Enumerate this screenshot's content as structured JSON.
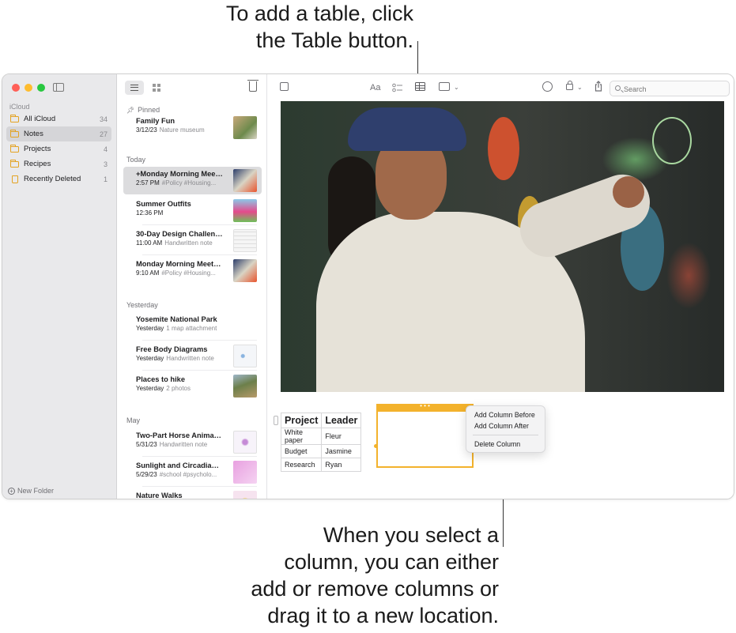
{
  "callouts": {
    "top_line1": "To add a table, click",
    "top_line2": "the Table button.",
    "bottom_line1": "When you select a",
    "bottom_line2": "column, you can either",
    "bottom_line3": "add or remove columns or",
    "bottom_line4": "drag it to a new location."
  },
  "sidebar": {
    "section": "iCloud",
    "folders": [
      {
        "name": "All iCloud",
        "count": "34"
      },
      {
        "name": "Notes",
        "count": "27"
      },
      {
        "name": "Projects",
        "count": "4"
      },
      {
        "name": "Recipes",
        "count": "3"
      },
      {
        "name": "Recently Deleted",
        "count": "1"
      }
    ],
    "new_folder": "New Folder"
  },
  "notelist": {
    "groups": [
      "Pinned",
      "Today",
      "Yesterday",
      "May"
    ],
    "notes": [
      {
        "title": "Family Fun",
        "date": "3/12/23",
        "snippet": "Nature museum"
      },
      {
        "title": "+Monday Morning Meeting",
        "date": "2:57 PM",
        "snippet": "#Policy #Housing..."
      },
      {
        "title": "Summer Outfits",
        "date": "12:36 PM",
        "snippet": ""
      },
      {
        "title": "30-Day Design Challenge",
        "date": "11:00 AM",
        "snippet": "Handwritten note"
      },
      {
        "title": "Monday Morning Meeting",
        "date": "9:10 AM",
        "snippet": "#Policy #Housing..."
      },
      {
        "title": "Yosemite National Park",
        "date": "Yesterday",
        "snippet": "1 map attachment"
      },
      {
        "title": "Free Body Diagrams",
        "date": "Yesterday",
        "snippet": "Handwritten note"
      },
      {
        "title": "Places to hike",
        "date": "Yesterday",
        "snippet": "2 photos"
      },
      {
        "title": "Two-Part Horse Animation",
        "date": "5/31/23",
        "snippet": "Handwritten note"
      },
      {
        "title": "Sunlight and Circadian Rhythms",
        "date": "5/29/23",
        "snippet": "#school #psycholo..."
      },
      {
        "title": "Nature Walks",
        "date": "",
        "snippet": ""
      }
    ]
  },
  "editor": {
    "format_label": "Aa",
    "search_placeholder": "Search",
    "table": {
      "headers": [
        "Project",
        "Leader"
      ],
      "rows": [
        [
          "White paper",
          "Fleur"
        ],
        [
          "Budget",
          "Jasmine"
        ],
        [
          "Research",
          "Ryan"
        ]
      ]
    },
    "column_handle": "• • •",
    "context_menu": [
      "Add Column Before",
      "Add Column After",
      "Delete Column"
    ]
  },
  "colors": {
    "accent": "#f3b22c",
    "folder": "#e3a322",
    "close": "#ff5f57",
    "minimize": "#febc2e",
    "zoom": "#28c840"
  }
}
